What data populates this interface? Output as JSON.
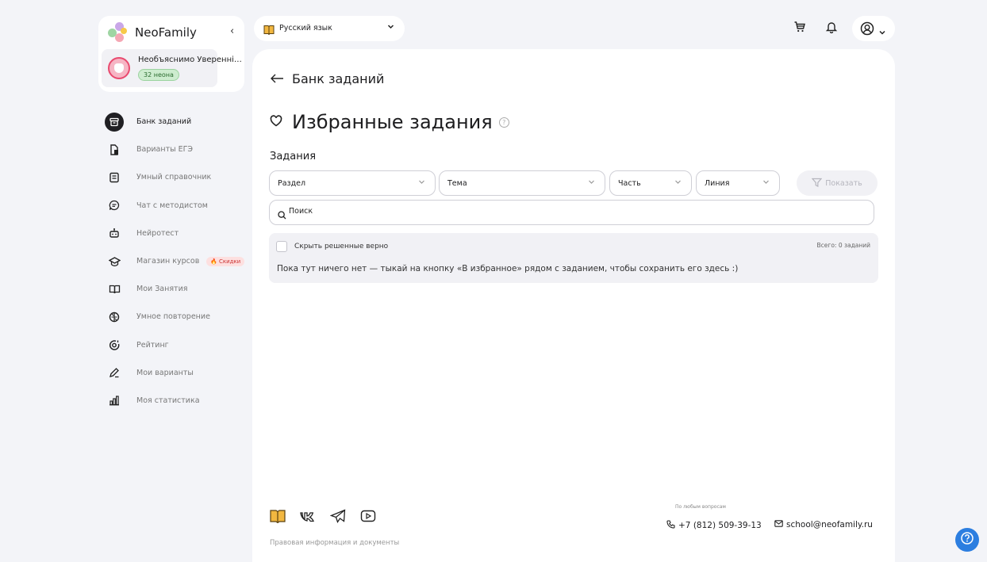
{
  "brand": {
    "name": "NeoFamily",
    "collapse_glyph": "‹"
  },
  "user": {
    "name": "Необъяснимо Увереннi…",
    "neons": "32 неона"
  },
  "nav": {
    "items": [
      {
        "label": "Банк заданий",
        "icon": "archive-icon",
        "active": true
      },
      {
        "label": "Варианты ЕГЭ",
        "icon": "documents-icon"
      },
      {
        "label": "Умный справочник",
        "icon": "handbook-icon"
      },
      {
        "label": "Чат с методистом",
        "icon": "chat-icon"
      },
      {
        "label": "Нейротест",
        "icon": "robot-icon"
      },
      {
        "label": "Магазин курсов",
        "icon": "graduation-cap-icon",
        "badge": "Скидки"
      },
      {
        "label": "Мои Занятия",
        "icon": "book-open-icon"
      },
      {
        "label": "Умное повторение",
        "icon": "brain-icon"
      },
      {
        "label": "Рейтинг",
        "icon": "target-icon"
      },
      {
        "label": "Мои варианты",
        "icon": "pencil-icon"
      },
      {
        "label": "Моя статистика",
        "icon": "bar-chart-icon"
      }
    ]
  },
  "topbar": {
    "subject": "Русский язык"
  },
  "main": {
    "back_label": "Банк заданий",
    "title": "Избранные задания",
    "help_glyph": "?",
    "section_label": "Задания",
    "filters": {
      "razdel": "Раздел",
      "tema": "Тема",
      "chast": "Часть",
      "liniya": "Линия"
    },
    "show_button": "Показать",
    "search_placeholder": "Поиск",
    "hide_solved_label": "Скрыть решенные верно",
    "total": "Всего: 0 заданий",
    "empty_message": "Пока тут ничего нет — тыкай на кнопку «В избранное» рядом с заданием, чтобы сохранить его здесь :)"
  },
  "footer": {
    "legal": "Правовая информация и документы",
    "any_question": "По любым вопросам",
    "phone": "+7 (812) 509-39-13",
    "email": "school@neofamily.ru"
  },
  "colors": {
    "accent": "#2c7ee0",
    "active_nav": "#1f1f23",
    "badge_bg": "#fde0e0",
    "neon_badge": "#cdeccf"
  }
}
